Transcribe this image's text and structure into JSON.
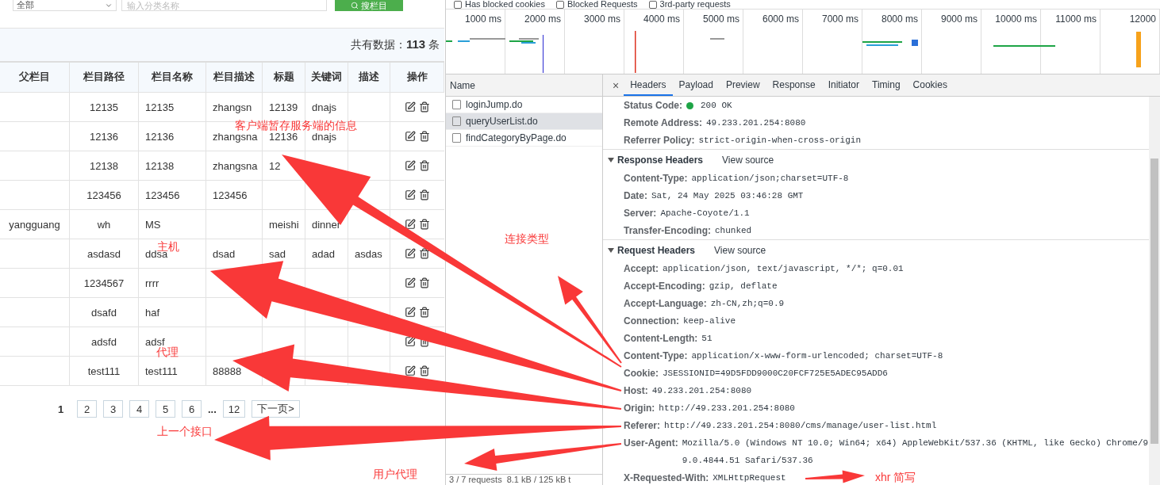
{
  "search_bar": {
    "category_select": "全部",
    "name_field": {
      "placeholder": "输入分类名称"
    },
    "search_button": "搜栏目"
  },
  "summary": "共有数据：**113** 条",
  "table": {
    "columns": [
      "父栏目",
      "栏目路径",
      "栏目名称",
      "栏目描述",
      "标题",
      "关键词",
      "描述",
      "操作"
    ],
    "rows": [
      {
        "cells": [
          "",
          "12135",
          "12135",
          "zhangsn",
          "12139",
          "dnajs",
          ""
        ]
      },
      {
        "cells": [
          "",
          "12136",
          "12136",
          "zhangsna",
          "12136",
          "dnajs",
          ""
        ]
      },
      {
        "cells": [
          "",
          "12138",
          "12138",
          "zhangsna",
          "12",
          "",
          ""
        ]
      },
      {
        "cells": [
          "",
          "123456",
          "123456",
          "123456",
          "",
          "",
          ""
        ]
      },
      {
        "cells": [
          "yangguang",
          "wh",
          "MS",
          "",
          "meishi",
          "dinner",
          ""
        ]
      },
      {
        "cells": [
          "",
          "asdasd",
          "ddsa",
          "dsad",
          "sad",
          "adad",
          "asdas"
        ]
      },
      {
        "cells": [
          "",
          "1234567",
          "rrrr",
          "",
          "",
          "",
          ""
        ]
      },
      {
        "cells": [
          "",
          "dsafd",
          "haf",
          "",
          "",
          "",
          ""
        ]
      },
      {
        "cells": [
          "",
          "adsfd",
          "adsf",
          "",
          "",
          "",
          ""
        ]
      },
      {
        "cells": [
          "",
          "test111",
          "test111",
          "88888",
          "",
          "",
          ""
        ]
      }
    ]
  },
  "pagination": {
    "pages": [
      {
        "label": "1",
        "selected": true
      },
      {
        "label": "2",
        "selected": false
      },
      {
        "label": "3",
        "selected": false
      },
      {
        "label": "4",
        "selected": false
      },
      {
        "label": "5",
        "selected": false
      },
      {
        "label": "6",
        "selected": false
      },
      {
        "label": "12",
        "selected": false
      }
    ],
    "ellipsis": "...",
    "next": "下一页>"
  },
  "devtools": {
    "filters": [
      {
        "label": "Has blocked cookies",
        "checked": false
      },
      {
        "label": "Blocked Requests",
        "checked": false
      },
      {
        "label": "3rd-party requests",
        "checked": false
      }
    ],
    "timeline_ticks": [
      "1000 ms",
      "2000 ms",
      "3000 ms",
      "4000 ms",
      "5000 ms",
      "6000 ms",
      "7000 ms",
      "8000 ms",
      "9000 ms",
      "10000 ms",
      "11000 ms",
      "12000"
    ],
    "name_header": "Name",
    "requests": [
      {
        "name": "loginJump.do",
        "selected": false
      },
      {
        "name": "queryUserList.do",
        "selected": true
      },
      {
        "name": "findCategoryByPage.do",
        "selected": false
      }
    ],
    "status_bar": [
      "3 / 7 requests",
      "8.1 kB / 125 kB t"
    ],
    "close": "×",
    "tabs": [
      {
        "label": "Headers",
        "selected": true
      },
      {
        "label": "Payload",
        "selected": false
      },
      {
        "label": "Preview",
        "selected": false
      },
      {
        "label": "Response",
        "selected": false
      },
      {
        "label": "Initiator",
        "selected": false
      },
      {
        "label": "Timing",
        "selected": false
      },
      {
        "label": "Cookies",
        "selected": false
      }
    ],
    "general": [
      {
        "name": "Status Code:",
        "value": "200 OK",
        "kind": "status"
      },
      {
        "name": "Remote Address:",
        "value": "49.233.201.254:8080",
        "kind": "field"
      },
      {
        "name": "Referrer Policy:",
        "value": "strict-origin-when-cross-origin",
        "kind": "field"
      }
    ],
    "sections": [
      {
        "title": "Response Headers",
        "view_source": "View source",
        "expanded": true,
        "rows": [
          {
            "name": "Content-Type:",
            "value": "application/json;charset=UTF-8"
          },
          {
            "name": "Date:",
            "value": "Sat, 24 May 2025 03:46:28 GMT"
          },
          {
            "name": "Server:",
            "value": "Apache-Coyote/1.1"
          },
          {
            "name": "Transfer-Encoding:",
            "value": "chunked"
          }
        ]
      },
      {
        "title": "Request Headers",
        "view_source": "View source",
        "expanded": true,
        "rows": [
          {
            "name": "Accept:",
            "value": "application/json, text/javascript, */*; q=0.01"
          },
          {
            "name": "Accept-Encoding:",
            "value": "gzip, deflate"
          },
          {
            "name": "Accept-Language:",
            "value": "zh-CN,zh;q=0.9"
          },
          {
            "name": "Connection:",
            "value": "keep-alive"
          },
          {
            "name": "Content-Length:",
            "value": "51"
          },
          {
            "name": "Content-Type:",
            "value": "application/x-www-form-urlencoded; charset=UTF-8"
          },
          {
            "name": "Cookie:",
            "value": "JSESSIONID=49D5FDD9000C20FCF725E5ADEC95ADD6"
          },
          {
            "name": "Host:",
            "value": "49.233.201.254:8080"
          },
          {
            "name": "Origin:",
            "value": "http://49.233.201.254:8080"
          },
          {
            "name": "Referer:",
            "value": "http://49.233.201.254:8080/cms/manage/user-list.html"
          },
          {
            "name": "User-Agent:",
            "value": "Mozilla/5.0 (Windows NT 10.0; Win64; x64) AppleWebKit/537.36 (KHTML, like Gecko) Chrome/99.0.4844.51 Safari/537.36"
          },
          {
            "name": "X-Requested-With:",
            "value": "XMLHttpRequest"
          }
        ]
      }
    ]
  },
  "annotations": [
    "客户端暂存服务端的信息",
    "主机",
    "连接类型",
    "代理",
    "上一个接口",
    "用户代理",
    "xhr 简写"
  ]
}
